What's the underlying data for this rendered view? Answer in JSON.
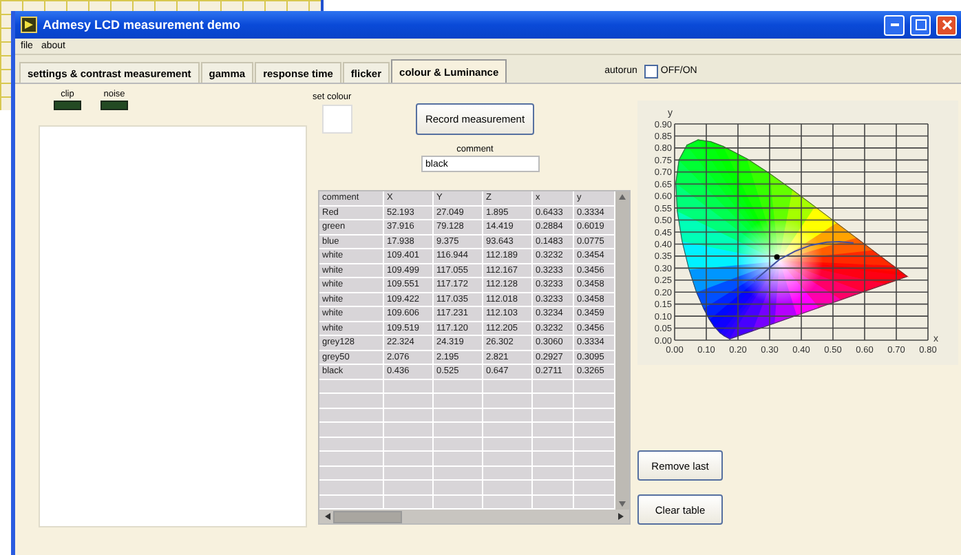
{
  "window": {
    "title": "Admesy LCD measurement demo"
  },
  "menu": [
    "file",
    "about"
  ],
  "tabs": [
    {
      "label": "settings & contrast measurement",
      "selected": false
    },
    {
      "label": "gamma",
      "selected": false
    },
    {
      "label": "response time",
      "selected": false
    },
    {
      "label": "flicker",
      "selected": false
    },
    {
      "label": "colour & Luminance",
      "selected": true
    }
  ],
  "autorun": {
    "label": "autorun",
    "option": "OFF/ON",
    "checked": false
  },
  "indicators": [
    {
      "label": "clip",
      "on": false
    },
    {
      "label": "noise",
      "on": false
    }
  ],
  "set_colour": {
    "label": "set colour"
  },
  "record_button": "Record measurement",
  "comment": {
    "label": "comment",
    "value": "black"
  },
  "table": {
    "columns": [
      "comment",
      "X",
      "Y",
      "Z",
      "x",
      "y"
    ],
    "rows": [
      [
        "Red",
        "52.193",
        "27.049",
        "1.895",
        "0.6433",
        "0.3334"
      ],
      [
        "green",
        "37.916",
        "79.128",
        "14.419",
        "0.2884",
        "0.6019"
      ],
      [
        "blue",
        "17.938",
        "9.375",
        "93.643",
        "0.1483",
        "0.0775"
      ],
      [
        "white",
        "109.401",
        "116.944",
        "112.189",
        "0.3232",
        "0.3454"
      ],
      [
        "white",
        "109.499",
        "117.055",
        "112.167",
        "0.3233",
        "0.3456"
      ],
      [
        "white",
        "109.551",
        "117.172",
        "112.128",
        "0.3233",
        "0.3458"
      ],
      [
        "white",
        "109.422",
        "117.035",
        "112.018",
        "0.3233",
        "0.3458"
      ],
      [
        "white",
        "109.606",
        "117.231",
        "112.103",
        "0.3234",
        "0.3459"
      ],
      [
        "white",
        "109.519",
        "117.120",
        "112.205",
        "0.3232",
        "0.3456"
      ],
      [
        "grey128",
        "22.324",
        "24.319",
        "26.302",
        "0.3060",
        "0.3334"
      ],
      [
        "grey50",
        "2.076",
        "2.195",
        "2.821",
        "0.2927",
        "0.3095"
      ],
      [
        "black",
        "0.436",
        "0.525",
        "0.647",
        "0.2711",
        "0.3265"
      ]
    ]
  },
  "chart": {
    "chart_data": {
      "type": "scatter",
      "xlabel": "x",
      "ylabel": "y",
      "xlim": [
        0,
        0.8
      ],
      "ylim": [
        0,
        0.9
      ],
      "xticks": [
        {
          "value": 0,
          "label": "0.00"
        },
        {
          "value": 0.1,
          "label": "0.10"
        },
        {
          "value": 0.2,
          "label": "0.20"
        },
        {
          "value": 0.3,
          "label": "0.30"
        },
        {
          "value": 0.4,
          "label": "0.40"
        },
        {
          "value": 0.5,
          "label": "0.50"
        },
        {
          "value": 0.6,
          "label": "0.60"
        },
        {
          "value": 0.7,
          "label": "0.70"
        },
        {
          "value": 0.8,
          "label": "0.80"
        }
      ],
      "yticks": [
        {
          "value": 0,
          "label": "0.00"
        },
        {
          "value": 0.05,
          "label": "0.05"
        },
        {
          "value": 0.1,
          "label": "0.10"
        },
        {
          "value": 0.15,
          "label": "0.15"
        },
        {
          "value": 0.2,
          "label": "0.20"
        },
        {
          "value": 0.25,
          "label": "0.25"
        },
        {
          "value": 0.3,
          "label": "0.30"
        },
        {
          "value": 0.35,
          "label": "0.35"
        },
        {
          "value": 0.4,
          "label": "0.40"
        },
        {
          "value": 0.45,
          "label": "0.45"
        },
        {
          "value": 0.5,
          "label": "0.50"
        },
        {
          "value": 0.55,
          "label": "0.55"
        },
        {
          "value": 0.6,
          "label": "0.60"
        },
        {
          "value": 0.65,
          "label": "0.65"
        },
        {
          "value": 0.7,
          "label": "0.70"
        },
        {
          "value": 0.75,
          "label": "0.75"
        },
        {
          "value": 0.8,
          "label": "0.80"
        },
        {
          "value": 0.85,
          "label": "0.85"
        },
        {
          "value": 0.9,
          "label": "0.90"
        }
      ],
      "x": [
        0.323
      ],
      "grid": true,
      "series": [
        {
          "color": "#000000",
          "values": [
            0.346
          ]
        }
      ]
    }
  },
  "buttons": [
    "Remove last",
    "Clear table"
  ]
}
